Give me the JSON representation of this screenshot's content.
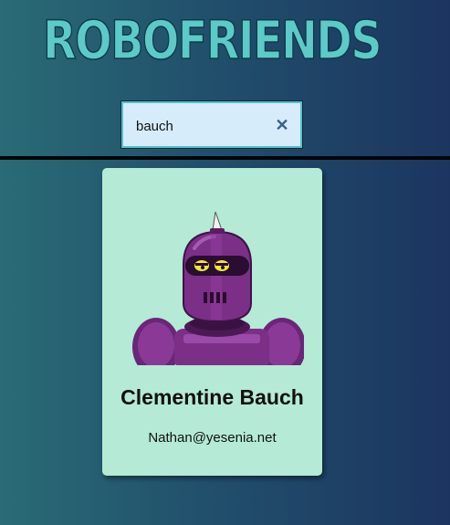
{
  "header": {
    "title": "ROBOFRIENDS"
  },
  "search": {
    "value": "bauch",
    "clear_icon": "close-icon"
  },
  "colors": {
    "title_fill": "#5ec9c9",
    "title_outline": "#0c3b46",
    "card_background": "#b5ead6",
    "robot_body": "#7b2f86"
  },
  "results": [
    {
      "name": "Clementine Bauch",
      "email": "Nathan@yesenia.net",
      "image": "robot-avatar"
    }
  ]
}
